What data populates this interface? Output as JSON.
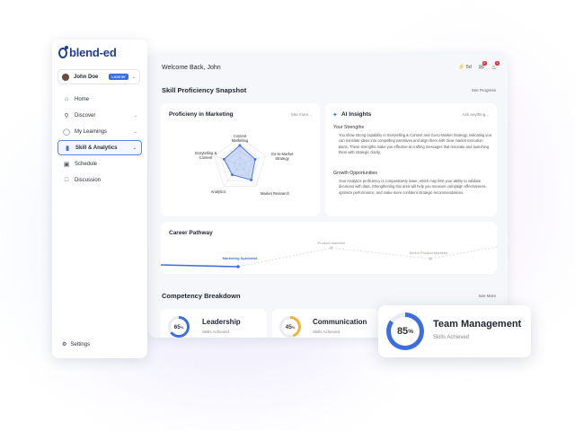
{
  "app": {
    "logo": "blend-ed"
  },
  "user": {
    "name": "John Doe",
    "role_badge": "Learner"
  },
  "sidebar": {
    "items": [
      {
        "label": "Home",
        "icon": "home-icon",
        "expandable": false
      },
      {
        "label": "Discover",
        "icon": "search-icon",
        "expandable": true
      },
      {
        "label": "My Learnings",
        "icon": "lightbulb-icon",
        "expandable": true
      },
      {
        "label": "Skill & Analytics",
        "icon": "bar-chart-icon",
        "expandable": true,
        "active": true
      },
      {
        "label": "Schedule",
        "icon": "calendar-icon",
        "expandable": false
      },
      {
        "label": "Discussion",
        "icon": "chat-icon",
        "expandable": false
      }
    ],
    "settings_label": "Settings"
  },
  "header": {
    "welcome": "Welcome Back, John",
    "streak": "5d",
    "notif_count": "2",
    "alert_count": "1"
  },
  "snapshot": {
    "title": "Skill Proficiency Snapshot",
    "link": "See Progress"
  },
  "proficiency": {
    "title": "Proficieny in Marketing",
    "link": "See more...",
    "axes": [
      "Content Marketing",
      "Go-to-Market Strategy",
      "Market Research",
      "Analytics",
      "Storytelling & Content"
    ],
    "values": [
      0.7,
      0.6,
      0.72,
      0.48,
      0.62
    ]
  },
  "ai": {
    "title": "AI Insights",
    "link": "Ask anything...",
    "strengths_heading": "Your Strengths",
    "strengths_text": "You show strong capability in Storytelling & Content and Go-to-Market Strategy, indicating you can translate ideas into compelling narratives and align them with clear market execution plans. These strengths make you effective at crafting messages that resonate and launching them with strategic clarity.",
    "growth_heading": "Growth Opportunities",
    "growth_text": "Your Analytics proficiency is comparatively lower, which may limit your ability to validate decisions with data. Strengthening this area will help you measure campaign effectiveness, optimize performance, and make more confident strategic recommendations."
  },
  "career": {
    "title": "Career Pathway",
    "steps": [
      "Marketing Specialist",
      "Product Marketer",
      "Senior Product Marketer"
    ],
    "progress": 0.3
  },
  "competency": {
    "title": "Competency Breakdown",
    "link": "See More",
    "items": [
      {
        "name": "Leadership",
        "sub": "Skills Achieved",
        "percent": 65,
        "color": "#3d6ee0"
      },
      {
        "name": "Communication",
        "sub": "Skills Achieved",
        "percent": 45,
        "color": "#f2b233"
      },
      {
        "name": "Team Management",
        "sub": "Skills Achieved",
        "percent": 85,
        "color": "#3d6ee0"
      }
    ]
  },
  "colors": {
    "accent": "#3d6ee0",
    "warning": "#f2b233",
    "alert": "#e0383b"
  }
}
